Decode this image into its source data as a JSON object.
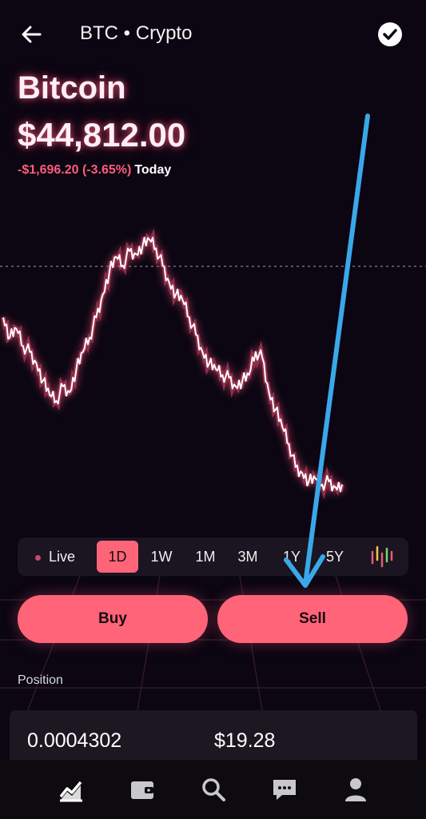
{
  "header": {
    "title": "BTC • Crypto",
    "back_icon": "arrow-left-icon",
    "check_icon": "check-circle-icon"
  },
  "asset": {
    "name": "Bitcoin",
    "price": "$44,812.00",
    "change": "-$1,696.20 (-3.65%)",
    "period": "Today"
  },
  "colors": {
    "accent": "#ff6479",
    "negative": "#ff5c7d",
    "background": "#0b0612",
    "annotation_arrow": "#3aa8e8"
  },
  "chart_data": {
    "type": "line",
    "title": "",
    "xlabel": "",
    "ylabel": "",
    "reference_line": "previous close",
    "series": [
      {
        "values": [
          0.62,
          0.55,
          0.58,
          0.52,
          0.5,
          0.46,
          0.4,
          0.35,
          0.33,
          0.38,
          0.36,
          0.44,
          0.5,
          0.55,
          0.62,
          0.7,
          0.78,
          0.83,
          0.8,
          0.85,
          0.84,
          0.87,
          0.89,
          0.86,
          0.8,
          0.74,
          0.7,
          0.68,
          0.62,
          0.56,
          0.5,
          0.46,
          0.44,
          0.42,
          0.41,
          0.38,
          0.4,
          0.42,
          0.5,
          0.48,
          0.36,
          0.3,
          0.24,
          0.18,
          0.1,
          0.08,
          0.05,
          0.06,
          0.04,
          0.05,
          0.03,
          0.04
        ]
      }
    ]
  },
  "ranges": {
    "live": "Live",
    "items": [
      "1D",
      "1W",
      "1M",
      "3M",
      "1Y",
      "5Y"
    ],
    "selected": "1D",
    "chart_type_icon": "candlestick-chart-icon"
  },
  "actions": {
    "buy": "Buy",
    "sell": "Sell"
  },
  "position": {
    "label": "Position",
    "quantity": "0.0004302",
    "value": "$19.28"
  },
  "nav": {
    "icons": [
      "chart-icon",
      "wallet-icon",
      "search-icon",
      "messages-icon",
      "profile-icon"
    ]
  }
}
